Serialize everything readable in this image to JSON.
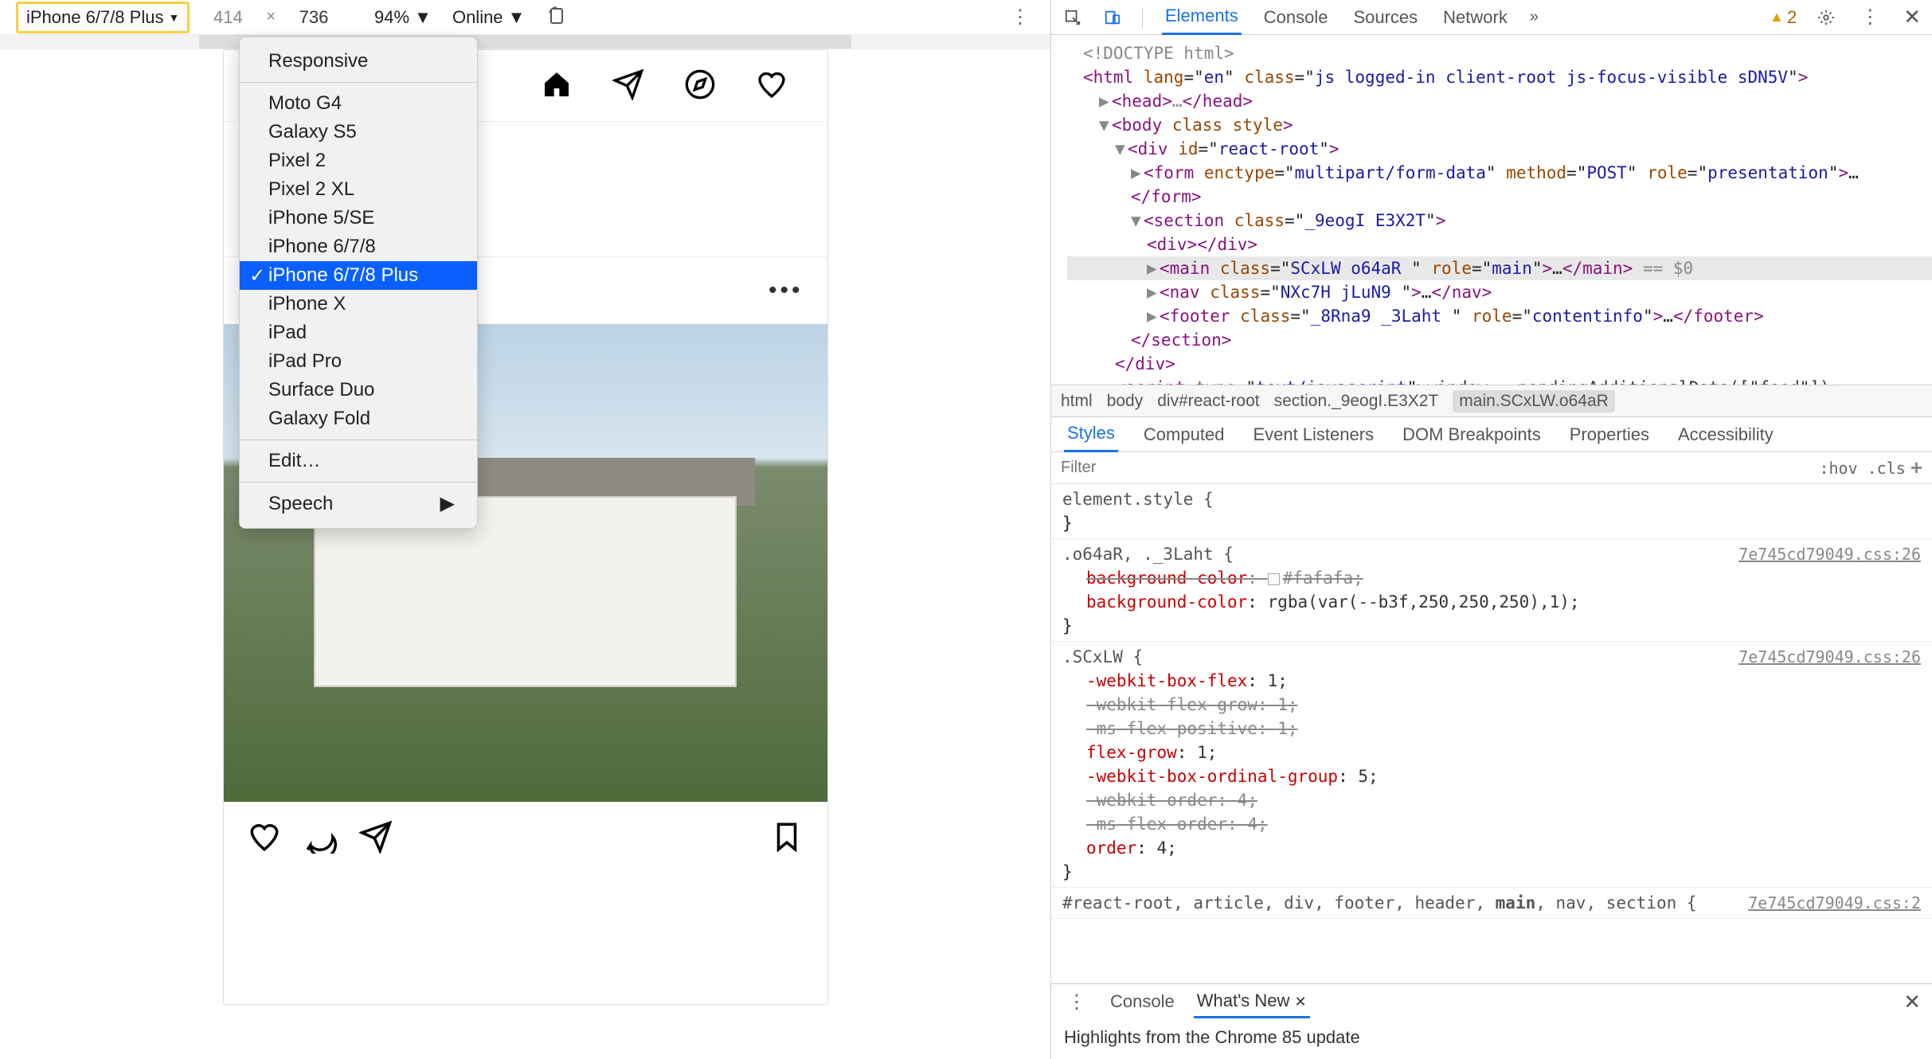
{
  "deviceToolbar": {
    "selectedDevice": "iPhone 6/7/8 Plus",
    "width": "414",
    "height": "736",
    "zoom": "94%",
    "throttle": "Online"
  },
  "deviceDropdown": {
    "top": "Responsive",
    "devices": [
      "Moto G4",
      "Galaxy S5",
      "Pixel 2",
      "Pixel 2 XL",
      "iPhone 5/SE",
      "iPhone 6/7/8",
      "iPhone 6/7/8 Plus",
      "iPhone X",
      "iPad",
      "iPad Pro",
      "Surface Duo",
      "Galaxy Fold"
    ],
    "selected": "iPhone 6/7/8 Plus",
    "edit": "Edit…",
    "speech": "Speech"
  },
  "devtools": {
    "tabs": [
      "Elements",
      "Console",
      "Sources",
      "Network"
    ],
    "activeTab": "Elements",
    "more": "»",
    "warningCount": "2",
    "crumbs": [
      "html",
      "body",
      "div#react-root",
      "section._9eogI.E3X2T",
      "main.SCxLW.o64aR"
    ],
    "styleTabs": [
      "Styles",
      "Computed",
      "Event Listeners",
      "DOM Breakpoints",
      "Properties",
      "Accessibility"
    ],
    "activeStyleTab": "Styles",
    "filterPlaceholder": "Filter",
    "hov": ":hov",
    "cls": ".cls"
  },
  "dom": {
    "l0": "<!DOCTYPE html>",
    "l1": {
      "open": "<html ",
      "a1": "lang",
      "v1": "en",
      "a2": "class",
      "v2": "js logged-in client-root js-focus-visible sDN5V",
      "close": ">"
    },
    "l2": {
      "open": "<head>",
      "mid": "…",
      "close": "</head>"
    },
    "l3": {
      "open": "<body ",
      "a1": "class",
      "a2": "style",
      "close": ">"
    },
    "l4": {
      "open": "<div ",
      "a1": "id",
      "v1": "react-root",
      "close": ">"
    },
    "l5": {
      "open": "<form ",
      "a1": "enctype",
      "v1": "multipart/form-data",
      "a2": "method",
      "v2": "POST",
      "a3": "role",
      "v3": "presentation",
      "close": ">…"
    },
    "l5c": "</form>",
    "l6": {
      "open": "<section ",
      "a1": "class",
      "v1": "_9eogI E3X2T",
      "close": ">"
    },
    "l7": "<div></div>",
    "l8": {
      "open": "<main ",
      "a1": "class",
      "v1": "SCxLW  o64aR ",
      "a2": "role",
      "v2": "main",
      "close": ">…</main>",
      "eq": " == $0"
    },
    "l9": {
      "open": "<nav ",
      "a1": "class",
      "v1": "NXc7H jLuN9  ",
      "close": ">…</nav>"
    },
    "l10": {
      "open": "<footer ",
      "a1": "class",
      "v1": "_8Rna9  _3Laht ",
      "a2": "role",
      "v2": "contentinfo",
      "close": ">…</footer>"
    },
    "l6c": "</section>",
    "l4c": "</div>",
    "l11": {
      "open": "<script ",
      "a1": "type",
      "v1": "text/javascript",
      "close": ">",
      "txt": "window.__pendingAdditionalData([\"feed\"]);"
    }
  },
  "styles": {
    "r0": {
      "sel": "element.style {",
      "body": "}"
    },
    "r1": {
      "sel": ".o64aR, ._3Laht {",
      "src": "7e745cd79049.css:26",
      "p1": {
        "n": "background-color",
        "v": "#fafafa;",
        "strike": true,
        "swatch": true
      },
      "p2": {
        "n": "background-color",
        "v": "rgba(var(--b3f,250,250,250),1);"
      },
      "close": "}"
    },
    "r2": {
      "sel": ".SCxLW {",
      "src": "7e745cd79049.css:26",
      "p1": {
        "n": "-webkit-box-flex",
        "v": "1;"
      },
      "p2": {
        "n": "-webkit-flex-grow",
        "v": "1;",
        "strike": true
      },
      "p3": {
        "n": "-ms-flex-positive",
        "v": "1;",
        "strike": true
      },
      "p4": {
        "n": "flex-grow",
        "v": "1;"
      },
      "p5": {
        "n": "-webkit-box-ordinal-group",
        "v": "5;"
      },
      "p6": {
        "n": "-webkit-order",
        "v": "4;",
        "strike": true
      },
      "p7": {
        "n": "-ms-flex-order",
        "v": "4;",
        "strike": true
      },
      "p8": {
        "n": "order",
        "v": "4;"
      },
      "close": "}"
    },
    "r3": {
      "sel": "#react-root, article, div, footer, header, main, nav, section {",
      "src": "7e745cd79049.css:2"
    }
  },
  "drawer": {
    "tabs": [
      "Console",
      "What's New"
    ],
    "active": "What's New",
    "body": "Highlights from the Chrome 85 update"
  }
}
